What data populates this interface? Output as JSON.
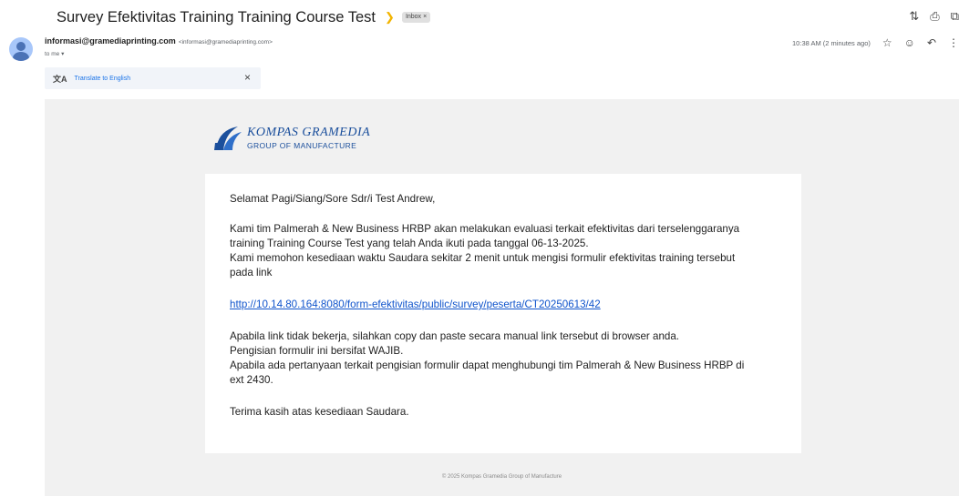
{
  "subject": "Survey Efektivitas Training Training Course Test",
  "inbox_label": "Inbox",
  "inbox_close": "×",
  "top_icons": [
    "collapse-icon",
    "print-icon",
    "open-new-window-icon"
  ],
  "sender": {
    "name": "informasi@gramediaprinting.com",
    "email": "<informasi@gramediaprinting.com>",
    "to": "to me",
    "time": "10:38 AM (2 minutes ago)"
  },
  "translate": {
    "label": "Translate to English",
    "close": "×"
  },
  "logo": {
    "title": "KOMPAS GRAMEDIA",
    "subtitle": "GROUP OF MANUFACTURE"
  },
  "body": {
    "greeting": "Selamat Pagi/Siang/Sore Sdr/i Test Andrew,",
    "para1_line1": "Kami tim Palmerah & New Business HRBP akan melakukan evaluasi terkait efektivitas dari terselenggaranya",
    "para1_line2": "training Training Course Test yang telah Anda ikuti pada tanggal 06-13-2025.",
    "para1_line3": "Kami memohon kesediaan waktu Saudara sekitar 2 menit untuk mengisi formulir efektivitas training tersebut",
    "para1_line4": "pada link",
    "link": "http://10.14.80.164:8080/form-efektivitas/public/survey/peserta/CT20250613/42",
    "para2_line1": "Apabila link tidak bekerja, silahkan copy dan paste secara manual link tersebut di browser anda.",
    "para2_line2": "Pengisian formulir ini bersifat WAJIB.",
    "para2_line3": "Apabila ada pertanyaan terkait pengisian formulir dapat menghubungi tim Palmerah & New Business HRBP di",
    "para2_line4": "ext 2430.",
    "closing": "Terima kasih atas kesediaan Saudara."
  },
  "footer": "© 2025 Kompas Gramedia Group of Manufacture",
  "colors": {
    "link": "#1155cc",
    "brand": "#1b4f9c",
    "importance": "#f2b400"
  }
}
